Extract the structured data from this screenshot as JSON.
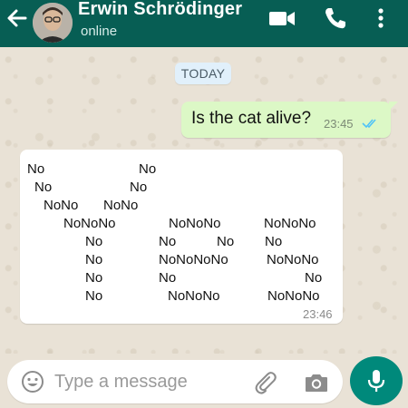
{
  "header": {
    "contact_name": "Erwin Schrödinger",
    "status": "online",
    "icons": [
      "back-arrow-icon",
      "video-call-icon",
      "voice-call-icon",
      "more-options-icon"
    ],
    "color": "#075e54"
  },
  "chat": {
    "day_label": "TODAY",
    "messages": [
      {
        "direction": "outgoing",
        "text": "Is the cat alive?",
        "time": "23:45",
        "status": "read",
        "bubble_color": "#dcf8c6"
      },
      {
        "direction": "incoming",
        "time": "23:46",
        "bubble_color": "#ffffff",
        "lines": [
          "No                    No",
          " No                  No",
          "  NoNo    NoNo",
          "    NoNoNo      NoNoNo      NoNoNo",
          "       No         No       No      No",
          "       No         NoNoNoNo      NoNoNo",
          "       No         No                        No",
          "       No           NoNoNo        NoNoNo"
        ]
      }
    ]
  },
  "composer": {
    "placeholder": "Type a message",
    "value": "",
    "icons": [
      "emoji-icon",
      "attach-icon",
      "camera-icon",
      "mic-icon"
    ],
    "mic_button_color": "#00897b"
  }
}
